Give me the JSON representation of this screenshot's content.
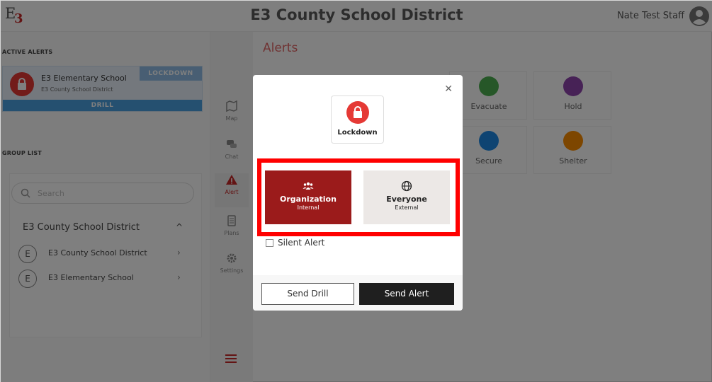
{
  "header": {
    "logo_e": "E",
    "logo_3": "3",
    "title": "E3 County School District",
    "user_name": "Nate Test Staff"
  },
  "left_panel": {
    "active_alerts_title": "ACTIVE ALERTS",
    "active_alert": {
      "school": "E3 Elementary School",
      "district": "E3 County School District",
      "badge": "LOCKDOWN",
      "mode": "DRILL"
    },
    "group_list_title": "GROUP LIST",
    "search_placeholder": "Search",
    "group_header": "E3 County School District",
    "groups": [
      {
        "initial": "E",
        "label": "E3 County School District"
      },
      {
        "initial": "E",
        "label": "E3 Elementary School"
      }
    ]
  },
  "nav": {
    "items": [
      {
        "label": "Map",
        "icon": "map-icon"
      },
      {
        "label": "Chat",
        "icon": "chat-icon"
      },
      {
        "label": "Alert",
        "icon": "alert-icon"
      },
      {
        "label": "Plans",
        "icon": "plans-icon"
      },
      {
        "label": "Settings",
        "icon": "gear-icon"
      }
    ]
  },
  "main": {
    "title": "Alerts",
    "tiles": [
      {
        "label": "Evacuate",
        "color": "#4caf50",
        "icon": "evacuate-icon"
      },
      {
        "label": "Hold",
        "color": "#8e44ad",
        "icon": "hold-icon"
      },
      {
        "label": "Secure",
        "color": "#1e88e5",
        "icon": "secure-icon"
      },
      {
        "label": "Shelter",
        "color": "#fb8c00",
        "icon": "shelter-icon"
      }
    ]
  },
  "modal": {
    "alert_type": "Lockdown",
    "audience": [
      {
        "title": "Organization",
        "subtitle": "Internal",
        "selected": true
      },
      {
        "title": "Everyone",
        "subtitle": "External",
        "selected": false
      }
    ],
    "silent_label": "Silent Alert",
    "drill_button": "Send Drill",
    "send_button": "Send Alert"
  },
  "colors": {
    "accent_red": "#c62828",
    "lockdown_red": "#e53935",
    "org_selected": "#9b1b1b",
    "highlight": "#ff0000"
  }
}
